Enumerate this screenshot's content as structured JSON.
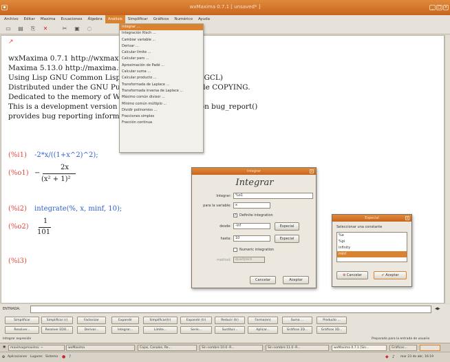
{
  "window": {
    "title": "wxMaxima 0.7.1 [ unsaved* ]"
  },
  "menubar": [
    "Archivo",
    "Editar",
    "Maxima",
    "Ecuaciones",
    "Álgebra",
    "Análisis",
    "Simplificar",
    "Gráficos",
    "Numérico",
    "Ayuda"
  ],
  "active_menu": "Análisis",
  "analysis_menu": [
    "Integrar ...",
    "Integración Risch ...",
    "Cambiar variable ...",
    "Derivar ...",
    "Calcular límite ...",
    "Calcular paro ...",
    "Aproximación de Padé ...",
    "Calcular suma ...",
    "Calcular producto ...",
    "Transformada de Laplace ...",
    "Transformada inversa de Laplace ...",
    "Máximo común divisor ...",
    "Mínimo común múltiplo ...",
    "Dividir polinomios ...",
    "Fracciones simples",
    "Fracción continua"
  ],
  "document": {
    "header": [
      "wxMaxima 0.7.1 http://wxmaxima.sourceforge.net",
      "Maxima 5.13.0 http://maxima.sourceforge.net",
      "Using Lisp GNU Common Lisp (GCL) GCL 2.6.8 (aka GCL)",
      "Distributed under the GNU Public License. See the file COPYING.",
      "Dedicated to the memory of William Schelter.",
      "This is a development version of Maxima. The function bug_report()",
      "provides bug reporting information."
    ],
    "cells": [
      {
        "label": "(%i1)",
        "text": "-2*x/((1+x^2)^2);"
      },
      {
        "label": "(%o1)",
        "text": "−",
        "num": "2x",
        "den": "(x² + 1)²"
      },
      {
        "label": "(%i2)",
        "text": "integrate(%, x, minf, 10);"
      },
      {
        "label": "(%o2)",
        "num": "1",
        "den": "101"
      },
      {
        "label": "(%i3)",
        "text": ""
      }
    ]
  },
  "integrate_dialog": {
    "title": "Integrar",
    "heading": "Integrar",
    "integrand_label": "Integrar:",
    "integrand_value": "%o1",
    "variable_label": "para la variable:",
    "variable_value": "x",
    "definite_label": "Definite integration",
    "from_label": "desde:",
    "from_value": "-inf",
    "to_label": "hasta:",
    "to_value": "10",
    "special_label": "Especial",
    "numeric_label": "Numeric integration",
    "method_label": "method:",
    "method_value": "quadpack",
    "cancel": "Cancelar",
    "accept": "Aceptar"
  },
  "constant_dialog": {
    "title": "Especial",
    "prompt": "Seleccionar una constante",
    "options": [
      "%e",
      "%pi",
      "infinity",
      "minf"
    ],
    "selected_index": 3,
    "cancel": "Cancelar",
    "accept": "Aceptar"
  },
  "panel": {
    "input_label": "ENTRADA:",
    "row1": [
      "Simplificar",
      "Simplificar (r)",
      "Factorizar",
      "Expandir",
      "Simplificar(tr)",
      "Expandir (tr)",
      "Reducir (tr)",
      "Forma(en)",
      "Suma ...",
      "Producto ..."
    ],
    "row2": [
      "Resolver...",
      "Resolver EDO...",
      "Derivar...",
      "Integrar...",
      "Límite...",
      "Serie...",
      "Sustituir...",
      "Aplicar...",
      "Gráficos 2D...",
      "Gráficos 3D..."
    ]
  },
  "status": {
    "left": "Integrar expresión",
    "right": "Preparado para la entrada de usuario"
  },
  "taskbar": {
    "top_tasks": [
      "maxima@maxima: ~",
      "wxMaxima",
      "Cajas, Canales, Re...",
      "Sin nombre 10.0 -R...",
      "Sin nombre 11.0 -R...",
      "wxMaxima 0.7.1 [Sin...",
      "Gráficos..."
    ],
    "bottom_left": [
      "Aplicaciones",
      "Lugares",
      "Sistema"
    ],
    "clock": "mar 23 de abr, 16:19"
  },
  "colors": {
    "accent": "#d9822f",
    "input": "#2f5ec9",
    "label": "#e0483c"
  }
}
